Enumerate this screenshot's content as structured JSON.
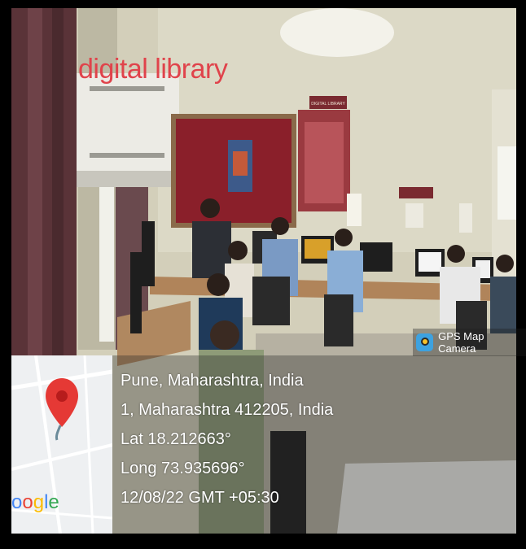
{
  "photo_caption": "digital library",
  "gps_badge": "GPS Map Camera",
  "location": {
    "place": "Pune, Maharashtra, India",
    "address": "1, Maharashtra 412205, India",
    "lat": "Lat 18.212663°",
    "long": "Long 73.935696°",
    "datetime": "12/08/22 GMT +05:30"
  },
  "map_brand": "Google",
  "sign_board": "DIGITAL LIBRARY",
  "colors": {
    "caption": "#e0434b",
    "pin": "#e53935",
    "wall": "#d6d2bd",
    "board": "#8a1f2a"
  }
}
